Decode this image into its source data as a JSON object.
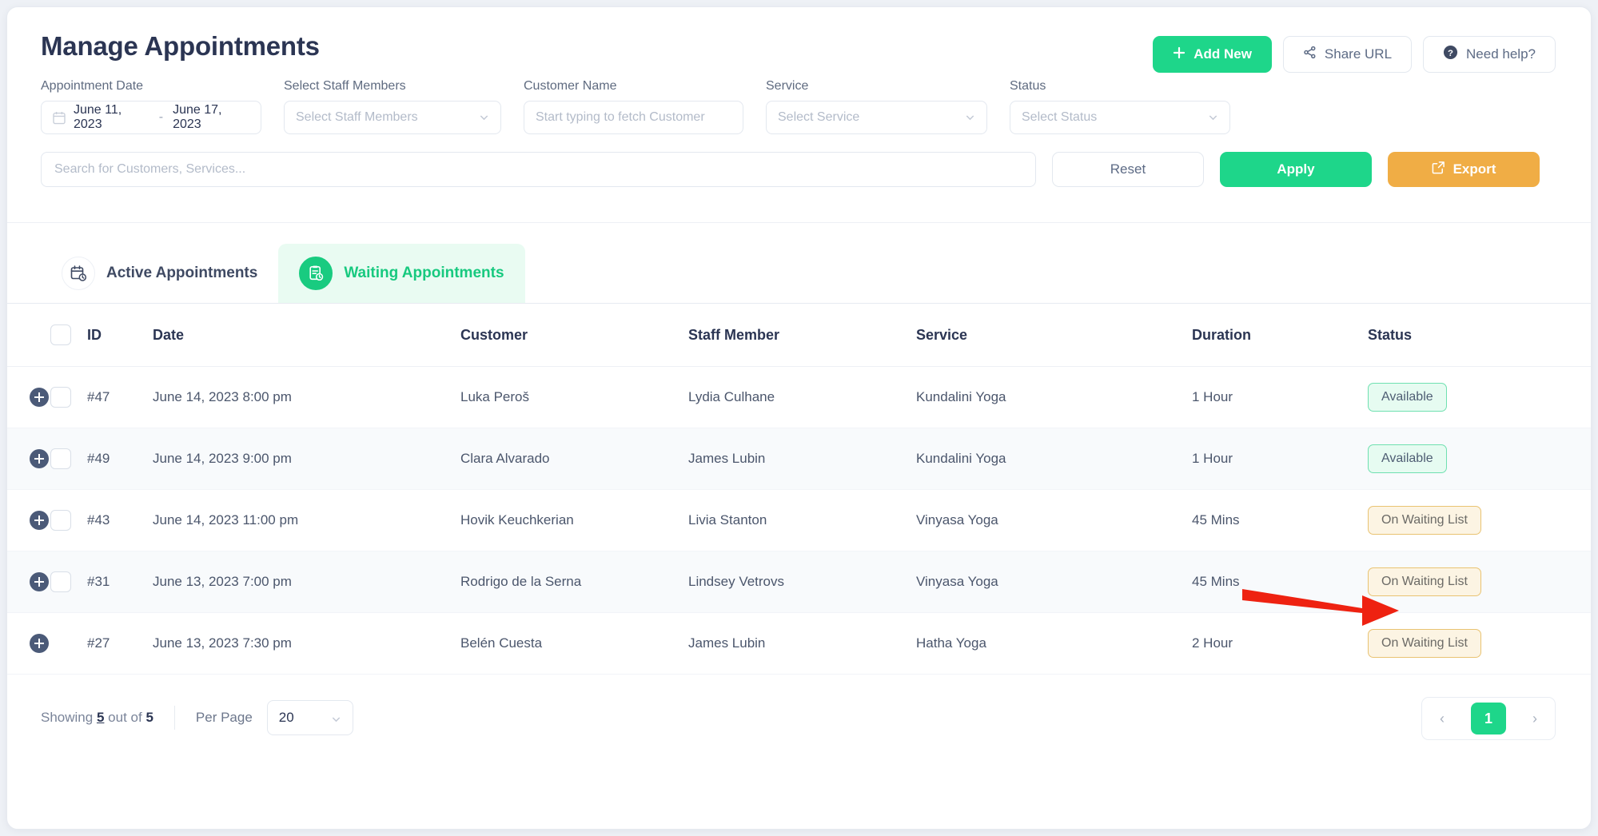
{
  "header": {
    "title": "Manage Appointments",
    "actions": [
      {
        "label": "Add New",
        "icon": "plus-icon"
      },
      {
        "label": "Share URL",
        "icon": "share-icon"
      },
      {
        "label": "Need help?",
        "icon": "question-circle-icon"
      }
    ]
  },
  "filters": {
    "appointment_date": {
      "label": "Appointment Date",
      "start": "June 11, 2023",
      "separator": "-",
      "end": "June 17, 2023",
      "icon": "calendar-icon"
    },
    "staff": {
      "label": "Select Staff Members",
      "placeholder": "Select Staff Members"
    },
    "customer": {
      "label": "Customer Name",
      "placeholder": "Start typing to fetch Customer"
    },
    "service": {
      "label": "Service",
      "placeholder": "Select Service"
    },
    "status": {
      "label": "Status",
      "placeholder": "Select Status"
    }
  },
  "search": {
    "placeholder": "Search for Customers, Services...",
    "reset_label": "Reset",
    "apply_label": "Apply",
    "export_label": "Export"
  },
  "tabs": [
    {
      "label": "Active Appointments",
      "icon": "calendar-clock-icon",
      "active": false
    },
    {
      "label": "Waiting Appointments",
      "icon": "clipboard-clock-icon",
      "active": true
    }
  ],
  "table": {
    "columns": [
      "ID",
      "Date",
      "Customer",
      "Staff Member",
      "Service",
      "Duration",
      "Status"
    ],
    "rows": [
      {
        "id": "#47",
        "date": "June 14, 2023 8:00 pm",
        "customer": "Luka Peroš",
        "staff": "Lydia Culhane",
        "service": "Kundalini Yoga",
        "duration": "1 Hour",
        "status": "Available",
        "status_kind": "available",
        "has_checkbox": true
      },
      {
        "id": "#49",
        "date": "June 14, 2023 9:00 pm",
        "customer": "Clara Alvarado",
        "staff": "James Lubin",
        "service": "Kundalini Yoga",
        "duration": "1 Hour",
        "status": "Available",
        "status_kind": "available",
        "has_checkbox": true
      },
      {
        "id": "#43",
        "date": "June 14, 2023 11:00 pm",
        "customer": "Hovik Keuchkerian",
        "staff": "Livia Stanton",
        "service": "Vinyasa Yoga",
        "duration": "45 Mins",
        "status": "On Waiting List",
        "status_kind": "waiting",
        "has_checkbox": true
      },
      {
        "id": "#31",
        "date": "June 13, 2023 7:00 pm",
        "customer": "Rodrigo de la Serna",
        "staff": "Lindsey Vetrovs",
        "service": "Vinyasa Yoga",
        "duration": "45 Mins",
        "status": "On Waiting List",
        "status_kind": "waiting",
        "has_checkbox": true
      },
      {
        "id": "#27",
        "date": "June 13, 2023 7:30 pm",
        "customer": "Belén Cuesta",
        "staff": "James Lubin",
        "service": "Hatha Yoga",
        "duration": "2 Hour",
        "status": "On Waiting List",
        "status_kind": "waiting",
        "has_checkbox": false
      }
    ]
  },
  "footer": {
    "showing_prefix": "Showing",
    "showing_count": "5",
    "showing_middle": "out of",
    "showing_total": "5",
    "per_page_label": "Per Page",
    "per_page_value": "20",
    "pagination": {
      "prev": "‹",
      "current": "1",
      "next": "›"
    }
  },
  "annotation": {
    "type": "arrow",
    "color": "#ee2211",
    "points_to": "status-badge-row-4"
  },
  "colors": {
    "accent_green": "#1ed68a",
    "accent_orange": "#f0ad45",
    "tab_active_bg": "#e9fbf2",
    "tab_active_text": "#17c97f",
    "badge_available_bg": "#e6fbf1",
    "badge_waiting_bg": "#fcf4e3",
    "title": "#2b3553"
  }
}
